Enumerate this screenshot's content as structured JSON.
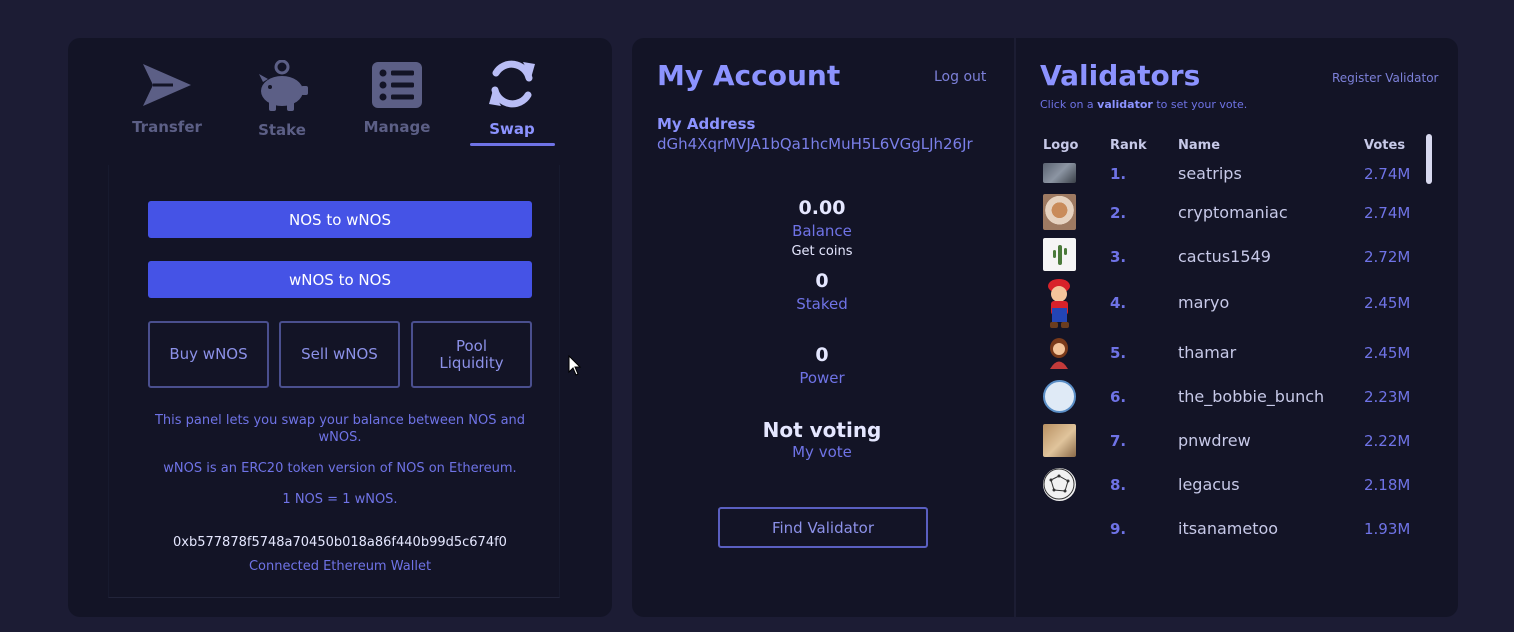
{
  "tabs": [
    {
      "label": "Transfer",
      "icon": "send-icon"
    },
    {
      "label": "Stake",
      "icon": "piggy-bank-icon"
    },
    {
      "label": "Manage",
      "icon": "list-icon"
    },
    {
      "label": "Swap",
      "icon": "sync-icon",
      "active": true
    }
  ],
  "swap": {
    "nos_to_wnos": "NOS to wNOS",
    "wnos_to_nos": "wNOS to NOS",
    "buy": "Buy wNOS",
    "sell": "Sell wNOS",
    "pool_line1": "Pool",
    "pool_line2": "Liquidity",
    "info1": "This panel lets you swap your balance between NOS and wNOS.",
    "info2": "wNOS is an ERC20 token version of NOS on Ethereum.",
    "info3": "1 NOS = 1 wNOS.",
    "eth_address": "0xb577878f5748a70450b018a86f440b99d5c674f0",
    "eth_label": "Connected Ethereum Wallet"
  },
  "account": {
    "title": "My Account",
    "logout": "Log out",
    "address_label": "My Address",
    "address": "dGh4XqrMVJA1bQa1hcMuH5L6VGgLJh26Jr",
    "balance": "0.00",
    "balance_label": "Balance",
    "get_coins": "Get coins",
    "staked": "0",
    "staked_label": "Staked",
    "power": "0",
    "power_label": "Power",
    "vote_status": "Not voting",
    "vote_label": "My vote",
    "find_validator": "Find Validator"
  },
  "validators": {
    "title": "Validators",
    "register": "Register Validator",
    "subtitle_pre": "Click on a ",
    "subtitle_bold": "validator",
    "subtitle_post": " to set your vote.",
    "columns": {
      "logo": "Logo",
      "rank": "Rank",
      "name": "Name",
      "votes": "Votes"
    },
    "rows": [
      {
        "rank": "1.",
        "name": "seatrips",
        "votes": "2.74M",
        "logo": "landscape-photo-icon"
      },
      {
        "rank": "2.",
        "name": "cryptomaniac",
        "votes": "2.74M",
        "logo": "cat-photo-icon"
      },
      {
        "rank": "3.",
        "name": "cactus1549",
        "votes": "2.72M",
        "logo": "cactus-icon"
      },
      {
        "rank": "4.",
        "name": "maryo",
        "votes": "2.45M",
        "logo": "mario-icon"
      },
      {
        "rank": "5.",
        "name": "thamar",
        "votes": "2.45M",
        "logo": "woman-avatar-icon"
      },
      {
        "rank": "6.",
        "name": "the_bobbie_bunch",
        "votes": "2.23M",
        "logo": "globe-logo-icon"
      },
      {
        "rank": "7.",
        "name": "pnwdrew",
        "votes": "2.22M",
        "logo": "tan-photo-icon"
      },
      {
        "rank": "8.",
        "name": "legacus",
        "votes": "2.18M",
        "logo": "network-logo-icon"
      },
      {
        "rank": "9.",
        "name": "itsanametoo",
        "votes": "1.93M",
        "logo": ""
      }
    ]
  },
  "colors": {
    "background": "#1c1c34",
    "panel": "#131426",
    "accent": "#8c93ff",
    "primary_button": "#4553e6"
  }
}
